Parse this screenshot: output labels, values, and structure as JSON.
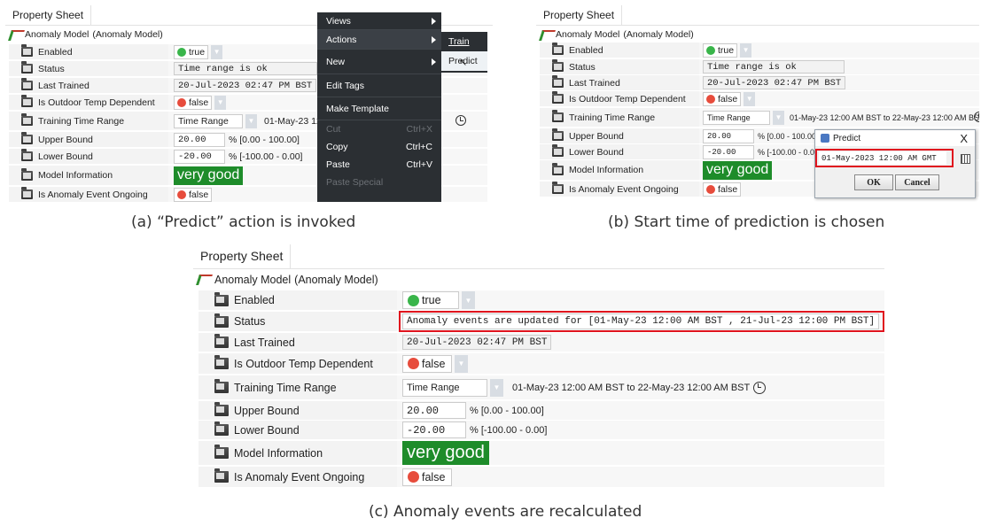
{
  "common": {
    "property_sheet_tab": "Property Sheet",
    "model_name": "Anomaly Model",
    "model_type": "(Anomaly Model)",
    "labels": {
      "enabled": "Enabled",
      "status": "Status",
      "last_trained": "Last Trained",
      "outdoor": "Is Outdoor Temp Dependent",
      "training_range": "Training Time Range",
      "upper": "Upper Bound",
      "lower": "Lower Bound",
      "model_info": "Model Information",
      "anomaly_ongoing": "Is Anomaly Event Ongoing"
    },
    "values": {
      "enabled": "true",
      "last_trained": "20-Jul-2023 02:47 PM BST",
      "outdoor": "false",
      "time_range_select": "Time Range",
      "upper": "20.00",
      "upper_range": "% [0.00 - 100.00]",
      "lower": "-20.00",
      "lower_range": "% [-100.00 - 0.00]",
      "model_info": "very good",
      "anomaly_ongoing": "false"
    },
    "colors": {
      "accent_green": "#1e8c2a",
      "highlight_red": "#e0141e",
      "menu_bg": "#2b2f33"
    }
  },
  "panel_a": {
    "status": "Time range is ok",
    "training_range_text": "01-May-23 12:00",
    "caption": "(a) “Predict” action is invoked",
    "menu": [
      {
        "label": "Views",
        "has_submenu": true
      },
      {
        "label": "Actions",
        "has_submenu": true
      },
      {
        "label": "New",
        "has_submenu": true
      },
      {
        "label": "Edit Tags"
      },
      {
        "label": "Make Template"
      },
      {
        "label": "Cut",
        "shortcut": "Ctrl+X",
        "disabled": true
      },
      {
        "label": "Copy",
        "shortcut": "Ctrl+C"
      },
      {
        "label": "Paste",
        "shortcut": "Ctrl+V"
      },
      {
        "label": "Paste Special",
        "disabled": true
      }
    ],
    "submenu": [
      "Train",
      "Predict"
    ]
  },
  "panel_b": {
    "status": "Time range is ok",
    "training_range_text": "01-May-23 12:00 AM BST to 22-May-23 12:00 AM BST",
    "caption": "(b) Start time of prediction is chosen",
    "dialog": {
      "title": "Predict",
      "close": "X",
      "date_value": "01-May-2023 12:00 AM GMT",
      "ok": "OK",
      "cancel": "Cancel"
    }
  },
  "panel_c": {
    "status": "Anomaly events are updated for [01-May-23 12:00 AM BST , 21-Jul-23 12:00 PM BST]",
    "training_range_text": "01-May-23 12:00 AM BST to 22-May-23 12:00 AM BST",
    "caption": "(c) Anomaly events are recalculated"
  }
}
